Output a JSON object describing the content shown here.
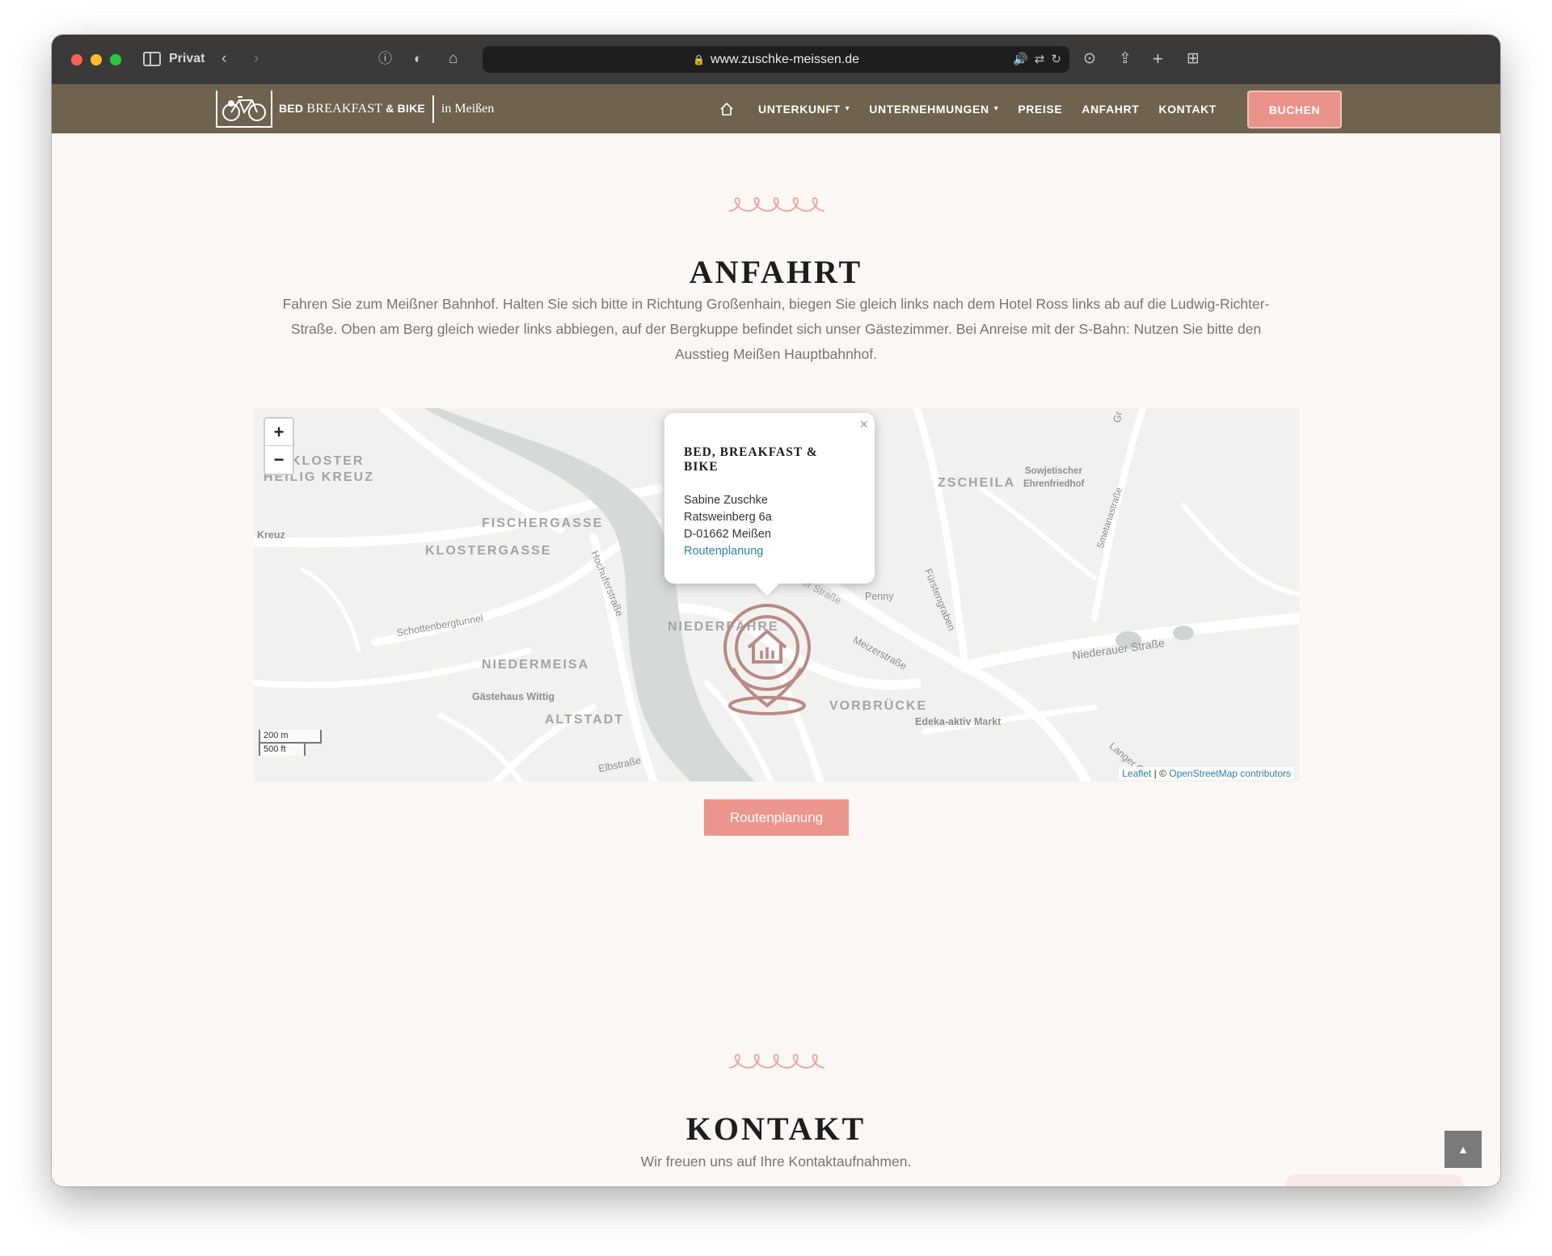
{
  "browser": {
    "private_label": "Privat",
    "url": "www.zuschke-meissen.de"
  },
  "site": {
    "logo": {
      "name_caps": "BED",
      "name_serif": "BREAKFAST",
      "name_amp": "& BIKE",
      "city": "in Meißen"
    },
    "nav": {
      "items": [
        {
          "label": "UNTERKUNFT",
          "dropdown": true
        },
        {
          "label": "UNTERNEHMUNGEN",
          "dropdown": true
        },
        {
          "label": "PREISE"
        },
        {
          "label": "ANFAHRT"
        },
        {
          "label": "KONTAKT"
        }
      ],
      "book_label": "BUCHEN"
    }
  },
  "anfahrt": {
    "title": "ANFAHRT",
    "text": "Fahren Sie zum Meißner Bahnhof. Halten Sie sich bitte in Richtung Großenhain, biegen Sie gleich links nach dem Hotel Ross links ab auf die Ludwig-Richter-Straße. Oben am Berg gleich wieder links abbiegen, auf der Bergkuppe befindet sich unser Gästezimmer. Bei Anreise mit der S-Bahn: Nutzen Sie bitte den Ausstieg Meißen Hauptbahnhof.",
    "route_button": "Routenplanung"
  },
  "map": {
    "zoom_in": "+",
    "zoom_out": "−",
    "labels": {
      "kloster": "KLOSTER",
      "heilig_kreuz": "HEILIG KREUZ",
      "fischergasse": "FISCHERGASSE",
      "klostergasse": "KLOSTERGASSE",
      "niedermeisa": "NIEDERMEISA",
      "altstadt": "ALTSTADT",
      "niederfaehre": "NIEDERFÄHRE",
      "vorbruecke": "VORBRÜCKE",
      "zscheila": "ZSCHEILA",
      "kreuz": "Kreuz",
      "schottenbergtunnel": "Schottenbergtunnel",
      "hochuferstrasse": "Hochuferstraße",
      "gaestehaus": "Gästehaus Wittig",
      "elbstrasse": "Elbstraße",
      "penny": "Penny",
      "meisner": "Meißner Straße",
      "meizerstrasse": "Meizerstraße",
      "fuerstengraben": "Fürstengraben",
      "edeka": "Edeka-aktiv Markt",
      "niederauer": "Niederauer Straße",
      "smetanastrasse": "Smetanastraße",
      "sowjetischer": "Sowjetischer",
      "ehrenfriedhof": "Ehrenfriedhof",
      "langer": "Langer G",
      "gr": "Gr"
    },
    "scale": {
      "m": "200 m",
      "ft": "500 ft"
    },
    "attribution": {
      "leaflet": "Leaflet",
      "sep": " | © ",
      "osm": "OpenStreetMap contributors"
    },
    "popup": {
      "close": "×",
      "title": "BED, BREAKFAST & BIKE",
      "name": "Sabine Zuschke",
      "street": "Ratsweinberg 6a",
      "city": "D-01662 Meißen",
      "link": "Routenplanung"
    },
    "colors": {
      "water": "#d5dad9",
      "roads": "#ffffff",
      "land": "#f1f1f0",
      "pin": "#b98a84"
    }
  },
  "kontakt": {
    "title": "KONTAKT",
    "subtitle": "Wir freuen uns auf Ihre Kontaktaufnahmen."
  },
  "theme": {
    "header_bg": "#6f624e",
    "accent": "#ec958d",
    "page_bg": "#fbf7f4"
  }
}
